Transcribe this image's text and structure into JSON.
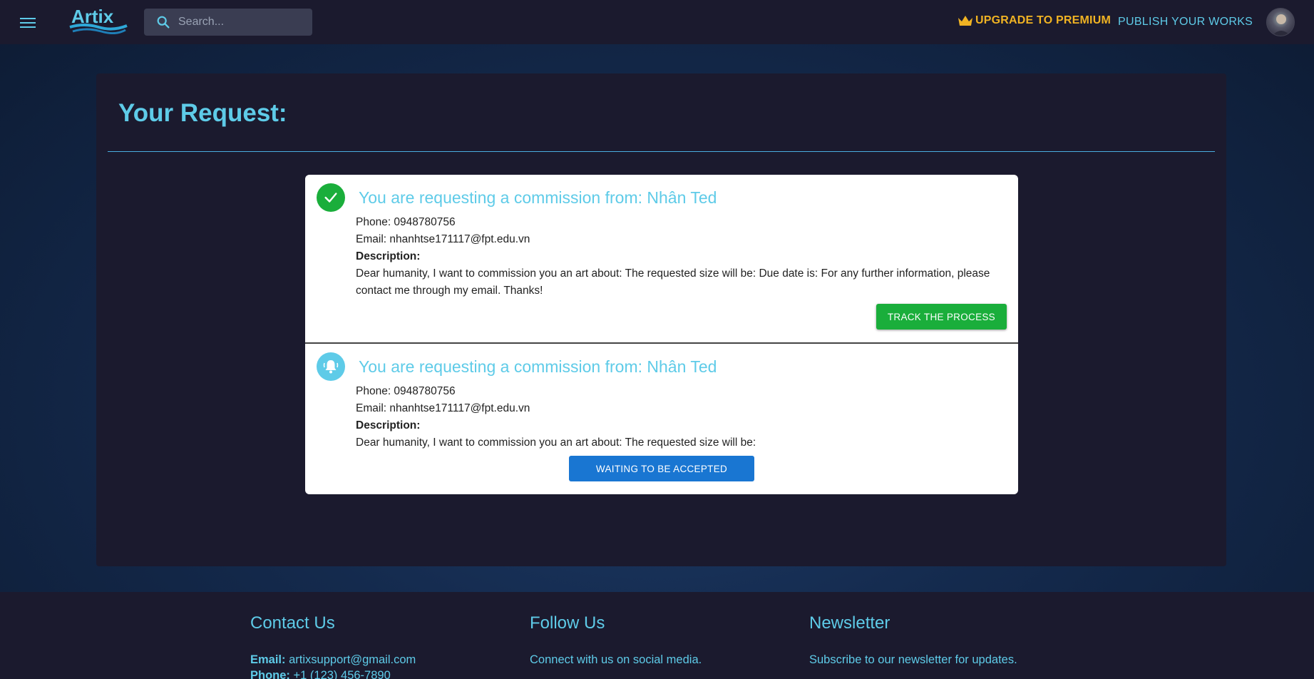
{
  "header": {
    "search_placeholder": "Search...",
    "premium_label": "UPGRADE TO PREMIUM",
    "publish_label": "PUBLISH YOUR WORKS",
    "brand": "Artix"
  },
  "page": {
    "title": "Your Request:"
  },
  "requests": [
    {
      "status": "accepted",
      "heading": "You are requesting a commission from: Nhân Ted",
      "phone": "Phone: 0948780756",
      "email": "Email: nhanhtse171117@fpt.edu.vn",
      "description_label": "Description:",
      "description": "Dear humanity, I want to commission you an art about: The requested size will be: Due date is: For any further information, please contact me through my email. Thanks!",
      "button_label": "TRACK THE PROCESS"
    },
    {
      "status": "pending",
      "heading": "You are requesting a commission from: Nhân Ted",
      "phone": "Phone: 0948780756",
      "email": "Email: nhanhtse171117@fpt.edu.vn",
      "description_label": "Description:",
      "description": "Dear humanity, I want to commission you an art about: The requested size will be:",
      "button_label": "WAITING TO BE ACCEPTED"
    }
  ],
  "footer": {
    "contact_title": "Contact Us",
    "email_label": "Email:",
    "email_value": "artixsupport@gmail.com",
    "phone_label": "Phone:",
    "phone_value": "+1 (123) 456-7890",
    "follow_title": "Follow Us",
    "follow_text": "Connect with us on social media.",
    "newsletter_title": "Newsletter",
    "newsletter_text": "Subscribe to our newsletter for updates."
  },
  "colors": {
    "accent": "#5ecbe8",
    "premium": "#f0b323",
    "success": "#1aae3b",
    "primary_button": "#1976d2",
    "panel_bg": "#1b1a2e"
  }
}
